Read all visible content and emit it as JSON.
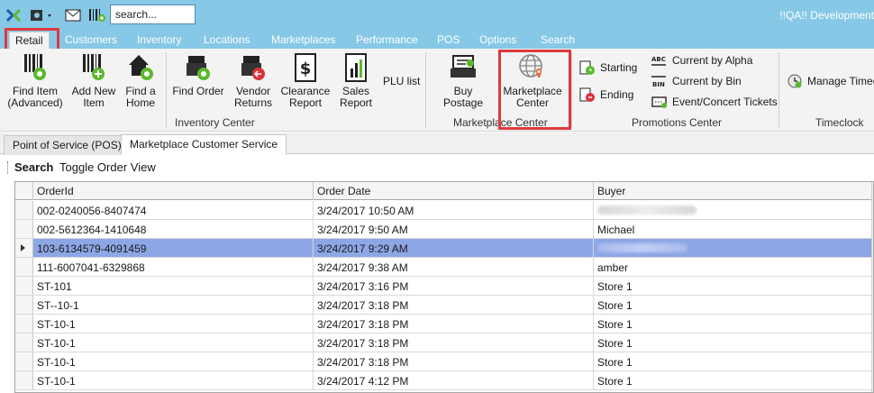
{
  "titlebar": {
    "search_value": "search...",
    "right_text": "!!QA!! Development"
  },
  "menu": {
    "tabs": [
      "Retail",
      "Customers",
      "Inventory",
      "Locations",
      "Marketplaces",
      "Performance",
      "POS",
      "Options",
      "Search"
    ]
  },
  "ribbon": {
    "inventory_center": {
      "label": "Inventory Center",
      "buttons": [
        {
          "line1": "Find Item",
          "line2": "(Advanced)"
        },
        {
          "line1": "Add New",
          "line2": "Item"
        },
        {
          "line1": "Find a",
          "line2": "Home"
        },
        {
          "line1": "Find Order",
          "line2": ""
        },
        {
          "line1": "Vendor",
          "line2": "Returns"
        },
        {
          "line1": "Clearance",
          "line2": "Report"
        },
        {
          "line1": "Sales",
          "line2": "Report"
        },
        {
          "line1": "PLU list",
          "line2": ""
        }
      ]
    },
    "marketplace_center": {
      "label": "Marketplace Center",
      "buttons": [
        {
          "line1": "Buy Postage",
          "line2": ""
        },
        {
          "line1": "Marketplace",
          "line2": "Center"
        }
      ]
    },
    "promotions_center": {
      "label": "Promotions Center",
      "items": [
        "Starting",
        "Ending",
        "Current by Alpha",
        "Current by Bin",
        "Event/Concert Tickets"
      ]
    },
    "timeclock": {
      "label": "Timeclock",
      "items": [
        "Manage Timeclock"
      ]
    }
  },
  "doc_tabs": [
    "Point of Service (POS)",
    "Marketplace Customer Service"
  ],
  "toolbar": {
    "search_label": "Search",
    "toggle_label": "Toggle Order View"
  },
  "grid": {
    "columns": [
      "OrderId",
      "Order Date",
      "Buyer"
    ],
    "rows": [
      {
        "order_id": "002-0240056-8407474",
        "order_date": "3/24/2017 10:50 AM",
        "buyer": ""
      },
      {
        "order_id": "002-5612364-1410648",
        "order_date": "3/24/2017 9:50 AM",
        "buyer": "Michael"
      },
      {
        "order_id": "103-6134579-4091459",
        "order_date": "3/24/2017 9:29 AM",
        "buyer": "",
        "selected": true
      },
      {
        "order_id": "111-6007041-6329868",
        "order_date": "3/24/2017 9:38 AM",
        "buyer": "amber"
      },
      {
        "order_id": "ST-101",
        "order_date": "3/24/2017 3:16 PM",
        "buyer": "Store 1"
      },
      {
        "order_id": "ST--10-1",
        "order_date": "3/24/2017 3:18 PM",
        "buyer": "Store 1"
      },
      {
        "order_id": "ST-10-1",
        "order_date": "3/24/2017 3:18 PM",
        "buyer": "Store 1"
      },
      {
        "order_id": "ST-10-1",
        "order_date": "3/24/2017 3:18 PM",
        "buyer": "Store 1"
      },
      {
        "order_id": "ST-10-1",
        "order_date": "3/24/2017 3:18 PM",
        "buyer": "Store 1"
      },
      {
        "order_id": "ST-10-1",
        "order_date": "3/24/2017 4:12 PM",
        "buyer": "Store 1"
      }
    ]
  },
  "colors": {
    "titlebar": "#86c8e6",
    "highlight_red": "#e0393e",
    "selected_row": "#8da6e6",
    "badge_green": "#5cb82e"
  }
}
